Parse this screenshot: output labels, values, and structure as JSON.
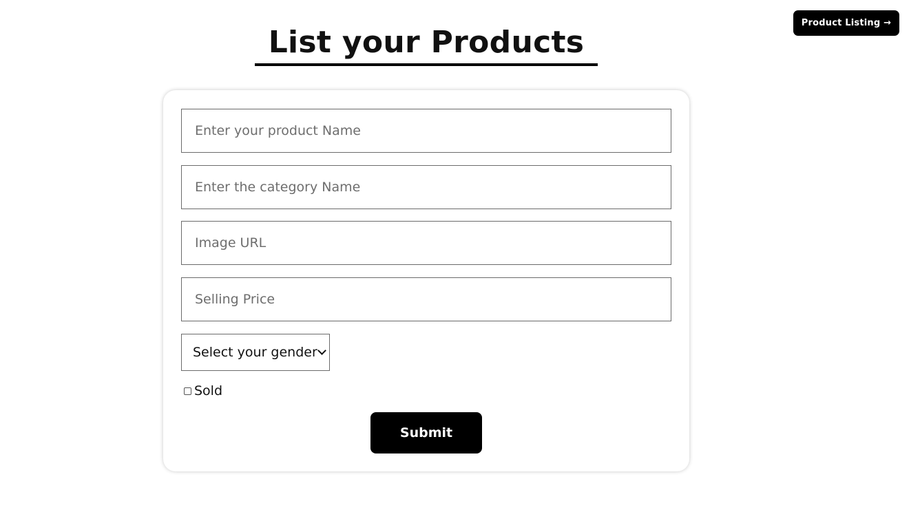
{
  "header": {
    "nav_button_label": "Product Listing →"
  },
  "page": {
    "title": "List your Products"
  },
  "form": {
    "product_name": {
      "placeholder": "Enter your product Name",
      "value": ""
    },
    "category_name": {
      "placeholder": "Enter the category Name",
      "value": ""
    },
    "image_url": {
      "placeholder": "Image URL",
      "value": ""
    },
    "selling_price": {
      "placeholder": "Selling Price",
      "value": ""
    },
    "gender_select": {
      "selected": "Select your gender"
    },
    "sold_checkbox": {
      "label": "Sold",
      "checked": false
    },
    "submit_label": "Submit"
  }
}
